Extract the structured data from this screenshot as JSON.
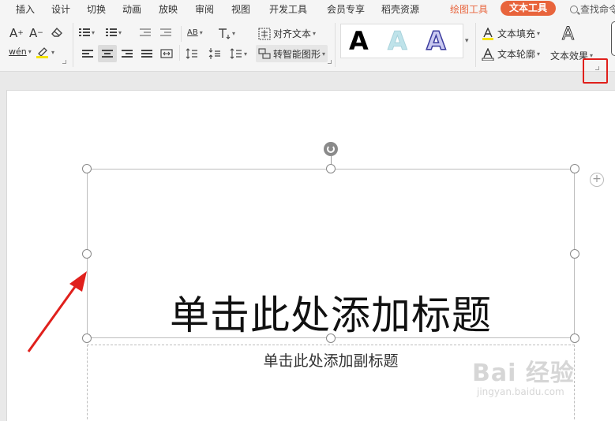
{
  "menu": {
    "items": [
      "插入",
      "设计",
      "切换",
      "动画",
      "放映",
      "审阅",
      "视图",
      "开发工具",
      "会员专享",
      "稻壳资源"
    ],
    "drawing_tools_tab": "绘图工具",
    "text_tools_tab": "文本工具",
    "search_label": "查找命令"
  },
  "ribbon": {
    "align_text_label": "对齐文本",
    "smart_shape_label": "转智能图形",
    "text_fill_label": "文本填充",
    "text_outline_label": "文本轮廓",
    "text_effect_label": "文本效果",
    "wordart_glyph": "A",
    "pinyin_label": "wén",
    "char_spacing_label": "AB"
  },
  "slide": {
    "title_placeholder": "单击此处添加标题",
    "subtitle_placeholder": "单击此处添加副标题",
    "plus": "+"
  },
  "watermark": {
    "brand": "Bai 经验",
    "url": "jingyan.baidu.com"
  },
  "colors": {
    "accent": "#e8643c",
    "highlight_box": "#e0201c",
    "annotation_arrow": "#e0201c"
  }
}
